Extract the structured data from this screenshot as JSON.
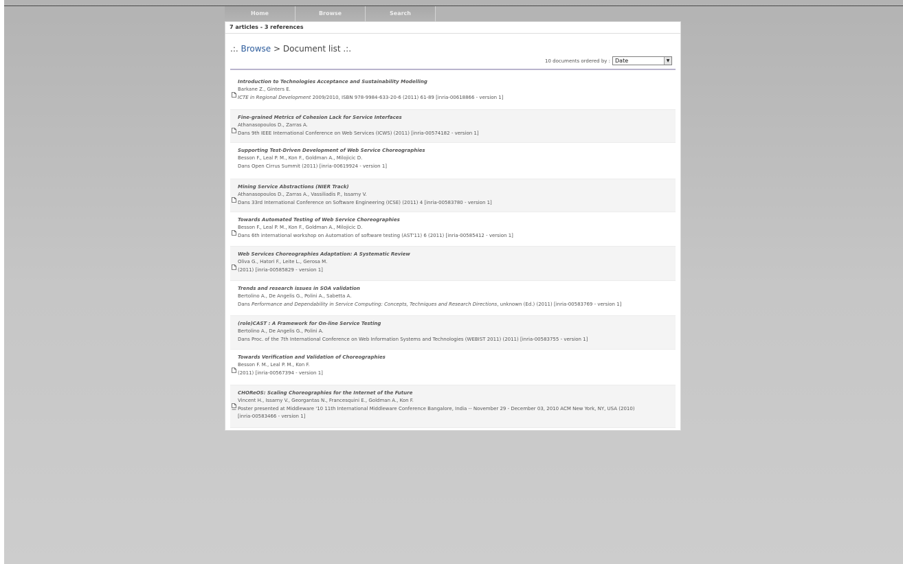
{
  "nav": [
    {
      "label": "Home"
    },
    {
      "label": "Browse"
    },
    {
      "label": "Search"
    }
  ],
  "summary": "7 articles - 3 references",
  "breadcrumb": {
    "prefix": ".:.",
    "link": "Browse",
    "sep": ">",
    "current": "Document list",
    "suffix": ".:."
  },
  "order": {
    "label": "10 documents ordered by :",
    "selected": "Date"
  },
  "documents": [
    {
      "title": "Introduction to Technologies Acceptance and Sustainability Modelling",
      "authors": "Barkane Z., Ginters E.",
      "venue": "ICTE in Regional Development",
      "ref": "2009/2010, ISBN 978-9984-633-20-6 (2011) 61-89 [inria-00618866 - version 1]",
      "icon": "document-icon"
    },
    {
      "title": "Fine-grained Metrics of Cohesion Lack for Service Interfaces",
      "authors": "Athanasopoulos D., Zarras A.",
      "ref": "Dans 9th IEEE International Conference on Web Services (ICWS) (2011) [inria-00574182 - version 1]",
      "icon": "document-icon"
    },
    {
      "title": "Supporting Test-Driven Development of Web Service Choreographies",
      "authors": "Besson F., Leal P. M., Kon F., Goldman A., Milojicic D.",
      "ref": "Dans Open Cirrus Summit (2011) [inria-00619924 - version 1]"
    },
    {
      "title": "Mining Service Abstractions (NIER Track)",
      "authors": "Athanasopoulos D., Zarras A., Vassiliadis P., Issarny V.",
      "ref": "Dans 33rd International Conference on Software Engineering (ICSE) (2011) 4 [inria-00583780 - version 1]",
      "icon": "document-icon"
    },
    {
      "title": "Towards Automated Testing of Web Service Choreographies",
      "authors": "Besson F., Leal P. M., Kon F., Goldman A., Milojicic D.",
      "ref": "Dans 6th international workshop on Automation of software testing (AST'11) 6 (2011) [inria-00585412 - version 1]",
      "icon": "document-icon"
    },
    {
      "title": "Web Services Choreographies Adaptation: A Systematic Review",
      "authors": "Oliva G., Hatori F., Leite L., Gerosa M.",
      "ref": "(2011) [inria-00585829 - version 1]",
      "icon": "document-icon"
    },
    {
      "title": "Trends and research issues in SOA validation",
      "authors": "Bertolino A., De Angelis G., Polini A., Sabetta A.",
      "refPrefix": "Dans",
      "refItalic": "Performance and Dependability in Service Computing: Concepts, Techniques and Research Directions",
      "refSuffix": ", unknown (Ed.) (2011) [inria-00583769 - version 1]"
    },
    {
      "title": "(role)CAST : A Framework for On-line Service Testing",
      "authors": "Bertolino A., De Angelis G., Polini A.",
      "ref": "Dans Proc. of the 7th International Conference on Web Information Systems and Technologies (WEBIST 2011) (2011) [inria-00583755 - version 1]"
    },
    {
      "title": "Towards Verification and Validation of Choreographies",
      "authors": "Besson F. M., Leal P. M., Kon F.",
      "ref": "(2011) [inria-00567394 - version 1]",
      "icon": "document-icon"
    },
    {
      "title": "CHOReOS: Scaling Choreographies for the Internet of the Future",
      "authors": "Vincent H., Issarny V., Georgantas N., Francesquini E., Goldman A., Kon F.",
      "ref": "Poster presented at Middleware '10 11th International Middleware Conference Bangalore, India -- November 29 - December 03, 2010 ACM New York, NY, USA (2010)",
      "ref2": "[inria-00583466 - version 1]",
      "icon": "poster-icon"
    }
  ]
}
